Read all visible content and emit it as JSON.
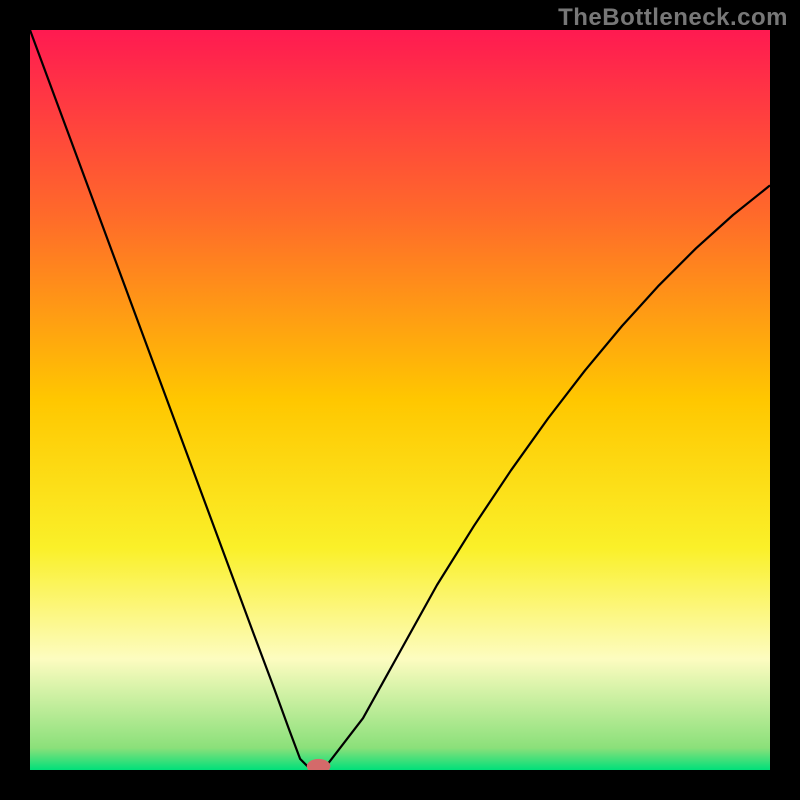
{
  "attribution": "TheBottleneck.com",
  "chart_data": {
    "type": "line",
    "title": "",
    "xlabel": "",
    "ylabel": "",
    "xlim": [
      0,
      100
    ],
    "ylim": [
      0,
      100
    ],
    "gradient_stops": [
      {
        "offset": 0,
        "color": "#ff1a51"
      },
      {
        "offset": 25,
        "color": "#ff6a2a"
      },
      {
        "offset": 50,
        "color": "#ffc700"
      },
      {
        "offset": 70,
        "color": "#faf029"
      },
      {
        "offset": 85,
        "color": "#fdfcc0"
      },
      {
        "offset": 97,
        "color": "#8be07a"
      },
      {
        "offset": 100,
        "color": "#00e07a"
      }
    ],
    "series": [
      {
        "name": "bottleneck-curve",
        "x": [
          0,
          5,
          10,
          15,
          20,
          25,
          30,
          33,
          35,
          36.5,
          38,
          39,
          40,
          45,
          50,
          55,
          60,
          65,
          70,
          75,
          80,
          85,
          90,
          95,
          100
        ],
        "y": [
          100,
          86.5,
          73,
          59.5,
          46,
          32.5,
          19,
          11,
          5.5,
          1.5,
          0,
          0,
          0.5,
          7,
          16,
          25,
          33,
          40.5,
          47.5,
          54,
          60,
          65.5,
          70.5,
          75,
          79
        ]
      }
    ],
    "marker": {
      "x": 39,
      "y": 0.5,
      "color": "#d46a6a",
      "rx": 1.6,
      "ry": 1.0
    },
    "flat_segment": {
      "x0": 36.8,
      "x1": 39,
      "y": 0
    }
  }
}
